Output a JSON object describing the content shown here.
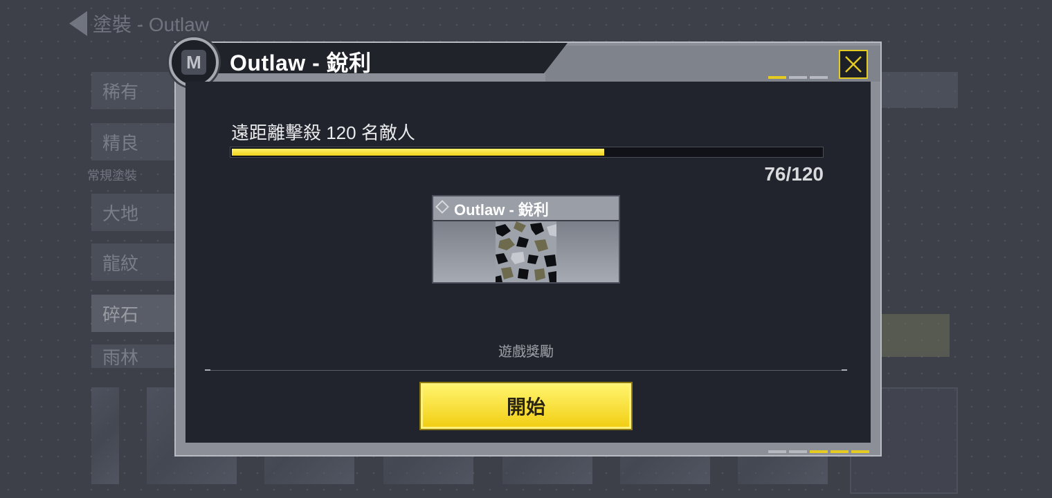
{
  "background": {
    "back_title": "塗裝 - Outlaw",
    "categories": [
      "稀有",
      "精良",
      "大地",
      "龍紋",
      "碎石",
      "雨林"
    ],
    "section_label": "常規塗裝"
  },
  "dialog": {
    "title": "Outlaw - 銳利",
    "badge_letter": "M",
    "task": {
      "label": "遠距離擊殺 120 名敵人",
      "current": 76,
      "total": 120,
      "progress_fraction": 0.633,
      "count_text": "76/120"
    },
    "reward": {
      "name": "Outlaw - 銳利"
    },
    "rewards_label": "遊戲獎勵",
    "start_label": "開始"
  },
  "colors": {
    "accent_yellow": "#f1d41c",
    "panel_dark": "#22242d",
    "frame_gray": "#8c8f97"
  },
  "icons": {
    "close": "close-icon",
    "badge": "mode-badge-icon",
    "reward": "diamond-icon"
  }
}
